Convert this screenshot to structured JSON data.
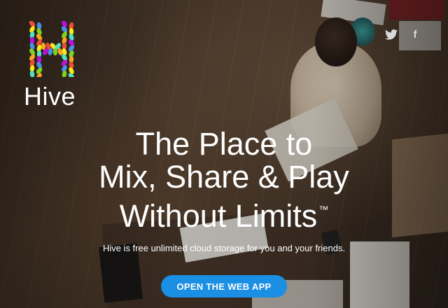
{
  "brand": {
    "name": "Hive"
  },
  "social": {
    "twitter_icon": "twitter-icon",
    "facebook_icon": "facebook-icon",
    "facebook_glyph": "f"
  },
  "hero": {
    "headline_line1": "The Place to",
    "headline_line2": "Mix, Share & Play",
    "headline_line3": "Without Limits",
    "trademark": "™",
    "subheading": "Hive is free unlimited cloud storage for you and your friends.",
    "cta_label": "OPEN THE WEB APP"
  },
  "colors": {
    "cta": "#1a8fe3",
    "text": "#ffffff",
    "logo_palette": [
      "#e94e3c",
      "#f5a623",
      "#7ed321",
      "#4a90e2",
      "#bd10e0",
      "#50e3c2",
      "#f8e71c"
    ]
  }
}
